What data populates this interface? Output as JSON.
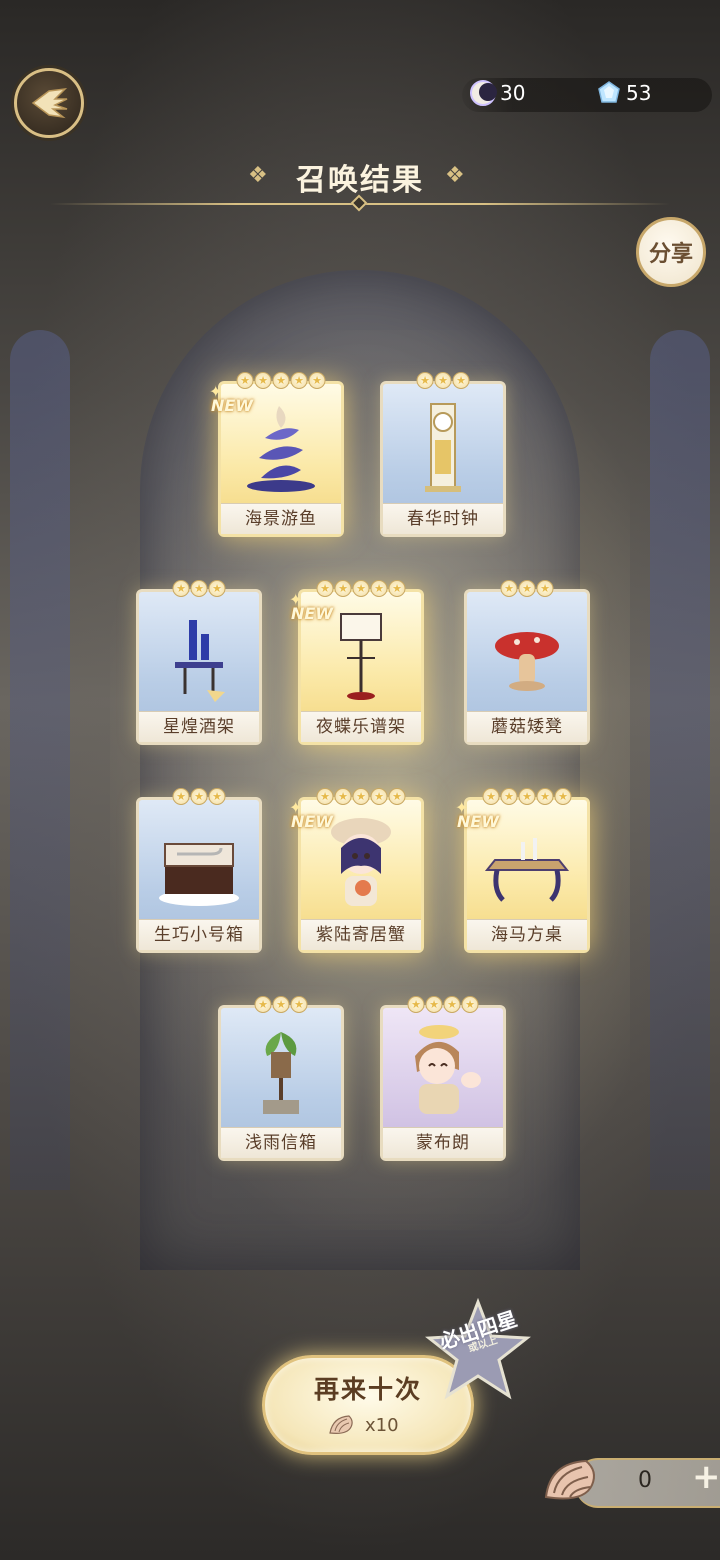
{
  "header": {
    "title": "召唤结果",
    "share_label": "分享",
    "currencies": [
      {
        "icon": "moon-icon",
        "value": "30"
      },
      {
        "icon": "crystal-icon",
        "value": "53"
      }
    ]
  },
  "cards": [
    {
      "name": "海景游鱼",
      "stars": 5,
      "new": true,
      "new_label": "NEW",
      "rarity_color": "#f2d57c"
    },
    {
      "name": "春华时钟",
      "stars": 3,
      "new": false,
      "rarity_color": "#a8bfdc"
    },
    {
      "name": "星煌酒架",
      "stars": 3,
      "new": false,
      "rarity_color": "#a8bfdc"
    },
    {
      "name": "夜蝶乐谱架",
      "stars": 5,
      "new": true,
      "new_label": "NEW",
      "rarity_color": "#f2d57c"
    },
    {
      "name": "蘑菇矮凳",
      "stars": 3,
      "new": false,
      "rarity_color": "#a8bfdc"
    },
    {
      "name": "生巧小号箱",
      "stars": 3,
      "new": false,
      "rarity_color": "#a8bfdc"
    },
    {
      "name": "紫陆寄居蟹",
      "stars": 5,
      "new": true,
      "new_label": "NEW",
      "rarity_color": "#f2d57c"
    },
    {
      "name": "海马方桌",
      "stars": 5,
      "new": true,
      "new_label": "NEW",
      "rarity_color": "#f2d57c"
    },
    {
      "name": "浅雨信箱",
      "stars": 3,
      "new": false,
      "rarity_color": "#a8bfdc"
    },
    {
      "name": "蒙布朗",
      "stars": 4,
      "new": false,
      "rarity_color": "#c8b8de"
    }
  ],
  "summon_again": {
    "label": "再来十次",
    "cost": "x10",
    "cost_icon": "shell-icon",
    "guarantee_main": "必出四星",
    "guarantee_sub": "或以上"
  },
  "shell_counter": {
    "value": "0",
    "plus": "+"
  }
}
